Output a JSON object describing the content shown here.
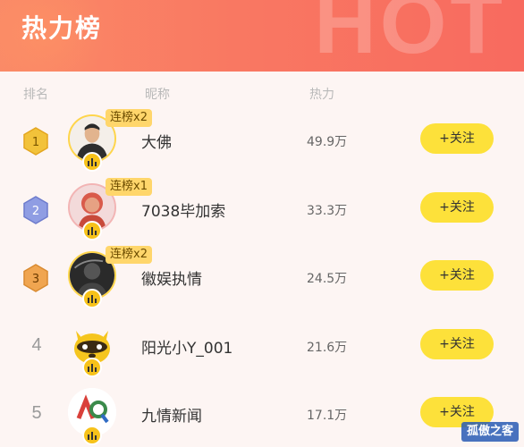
{
  "header": {
    "title": "热力榜",
    "watermark": "HOT"
  },
  "columns": {
    "rank": "排名",
    "name": "昵称",
    "heat": "热力"
  },
  "follow_label": "+关注",
  "rows": [
    {
      "rank": "1",
      "streak": "连榜x2",
      "name": "大佛",
      "heat": "49.9万",
      "medal": "gold"
    },
    {
      "rank": "2",
      "streak": "连榜x1",
      "name": "7038毕加索",
      "heat": "33.3万",
      "medal": "silver"
    },
    {
      "rank": "3",
      "streak": "连榜x2",
      "name": "徽娱执情",
      "heat": "24.5万",
      "medal": "bronze"
    },
    {
      "rank": "4",
      "name": "阳光小Y_001",
      "heat": "21.6万"
    },
    {
      "rank": "5",
      "name": "九情新闻",
      "heat": "17.1万"
    }
  ],
  "corner_logo": "孤傲之客",
  "colors": {
    "gold": "#f2c23a",
    "silver": "#8f9de3",
    "bronze": "#f0a550",
    "follow": "#fde13a"
  }
}
